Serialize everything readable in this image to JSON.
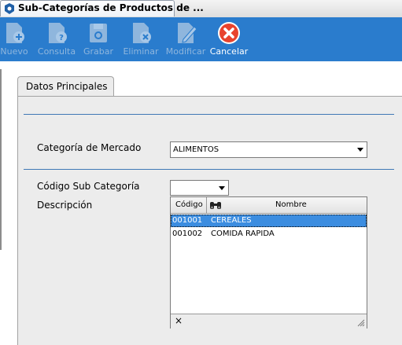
{
  "window": {
    "title": "Sub-Categorías de Productos de ..."
  },
  "toolbar": {
    "nuevo": "Nuevo",
    "consulta": "Consulta",
    "grabar": "Grabar",
    "eliminar": "Eliminar",
    "modificar": "Modificar",
    "cancelar": "Cancelar"
  },
  "tab": {
    "label": "Datos Principales"
  },
  "form": {
    "categoria_label": "Categoría de Mercado",
    "categoria_value": "ALIMENTOS",
    "codigo_label": "Código Sub Categoría",
    "codigo_value": "",
    "descripcion_label": "Descripción"
  },
  "grid": {
    "columns": [
      "Código",
      "Nombre"
    ],
    "rows": [
      {
        "codigo": "001001",
        "nombre": "CEREALES",
        "selected": true
      },
      {
        "codigo": "001002",
        "nombre": "COMIDA RAPIDA",
        "selected": false
      }
    ],
    "close_glyph": "×"
  },
  "colors": {
    "toolbar_bg": "#2a7ccd",
    "selection": "#3c8de0",
    "separator": "#3f78b5",
    "cancel_red": "#e8432d"
  }
}
